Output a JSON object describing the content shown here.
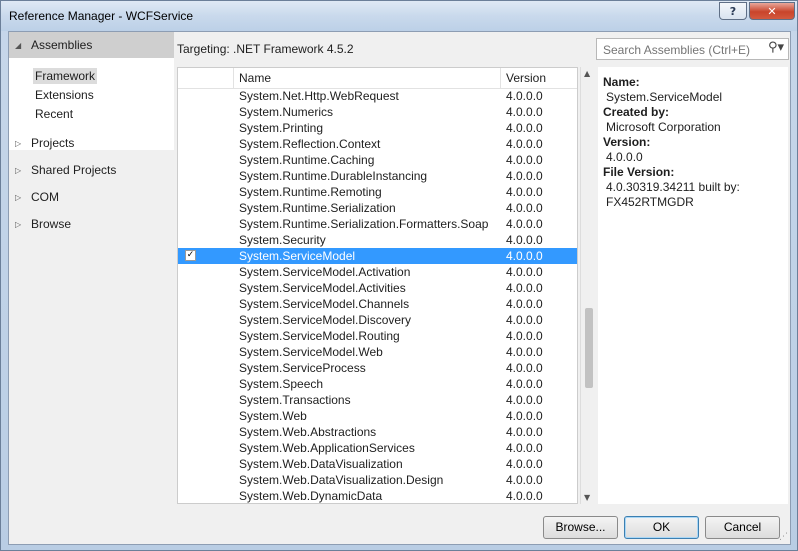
{
  "window": {
    "title": "Reference Manager - WCFService"
  },
  "titlebar_buttons": {
    "help": "?",
    "close": "✕"
  },
  "nav": {
    "assemblies": "Assemblies",
    "sub_items": [
      "Framework",
      "Extensions",
      "Recent"
    ],
    "groups": [
      "Projects",
      "Shared Projects",
      "COM",
      "Browse"
    ]
  },
  "targeting": "Targeting: .NET Framework 4.5.2",
  "search": {
    "placeholder": "Search Assemblies (Ctrl+E)"
  },
  "list": {
    "columns": {
      "name": "Name",
      "version": "Version"
    },
    "rows": [
      {
        "name": "System.Net.Http.WebRequest",
        "version": "4.0.0.0",
        "checked": false,
        "selected": false
      },
      {
        "name": "System.Numerics",
        "version": "4.0.0.0",
        "checked": false,
        "selected": false
      },
      {
        "name": "System.Printing",
        "version": "4.0.0.0",
        "checked": false,
        "selected": false
      },
      {
        "name": "System.Reflection.Context",
        "version": "4.0.0.0",
        "checked": false,
        "selected": false
      },
      {
        "name": "System.Runtime.Caching",
        "version": "4.0.0.0",
        "checked": false,
        "selected": false
      },
      {
        "name": "System.Runtime.DurableInstancing",
        "version": "4.0.0.0",
        "checked": false,
        "selected": false
      },
      {
        "name": "System.Runtime.Remoting",
        "version": "4.0.0.0",
        "checked": false,
        "selected": false
      },
      {
        "name": "System.Runtime.Serialization",
        "version": "4.0.0.0",
        "checked": false,
        "selected": false
      },
      {
        "name": "System.Runtime.Serialization.Formatters.Soap",
        "version": "4.0.0.0",
        "checked": false,
        "selected": false
      },
      {
        "name": "System.Security",
        "version": "4.0.0.0",
        "checked": false,
        "selected": false
      },
      {
        "name": "System.ServiceModel",
        "version": "4.0.0.0",
        "checked": true,
        "selected": true
      },
      {
        "name": "System.ServiceModel.Activation",
        "version": "4.0.0.0",
        "checked": false,
        "selected": false
      },
      {
        "name": "System.ServiceModel.Activities",
        "version": "4.0.0.0",
        "checked": false,
        "selected": false
      },
      {
        "name": "System.ServiceModel.Channels",
        "version": "4.0.0.0",
        "checked": false,
        "selected": false
      },
      {
        "name": "System.ServiceModel.Discovery",
        "version": "4.0.0.0",
        "checked": false,
        "selected": false
      },
      {
        "name": "System.ServiceModel.Routing",
        "version": "4.0.0.0",
        "checked": false,
        "selected": false
      },
      {
        "name": "System.ServiceModel.Web",
        "version": "4.0.0.0",
        "checked": false,
        "selected": false
      },
      {
        "name": "System.ServiceProcess",
        "version": "4.0.0.0",
        "checked": false,
        "selected": false
      },
      {
        "name": "System.Speech",
        "version": "4.0.0.0",
        "checked": false,
        "selected": false
      },
      {
        "name": "System.Transactions",
        "version": "4.0.0.0",
        "checked": false,
        "selected": false
      },
      {
        "name": "System.Web",
        "version": "4.0.0.0",
        "checked": false,
        "selected": false
      },
      {
        "name": "System.Web.Abstractions",
        "version": "4.0.0.0",
        "checked": false,
        "selected": false
      },
      {
        "name": "System.Web.ApplicationServices",
        "version": "4.0.0.0",
        "checked": false,
        "selected": false
      },
      {
        "name": "System.Web.DataVisualization",
        "version": "4.0.0.0",
        "checked": false,
        "selected": false
      },
      {
        "name": "System.Web.DataVisualization.Design",
        "version": "4.0.0.0",
        "checked": false,
        "selected": false
      },
      {
        "name": "System.Web.DynamicData",
        "version": "4.0.0.0",
        "checked": false,
        "selected": false
      }
    ]
  },
  "details": {
    "name_label": "Name:",
    "name_value": "System.ServiceModel",
    "created_label": "Created by:",
    "created_value": "Microsoft Corporation",
    "version_label": "Version:",
    "version_value": "4.0.0.0",
    "file_version_label": "File Version:",
    "file_version_value1": "4.0.30319.34211 built by:",
    "file_version_value2": "FX452RTMGDR"
  },
  "footer": {
    "browse": "Browse...",
    "ok": "OK",
    "cancel": "Cancel"
  }
}
